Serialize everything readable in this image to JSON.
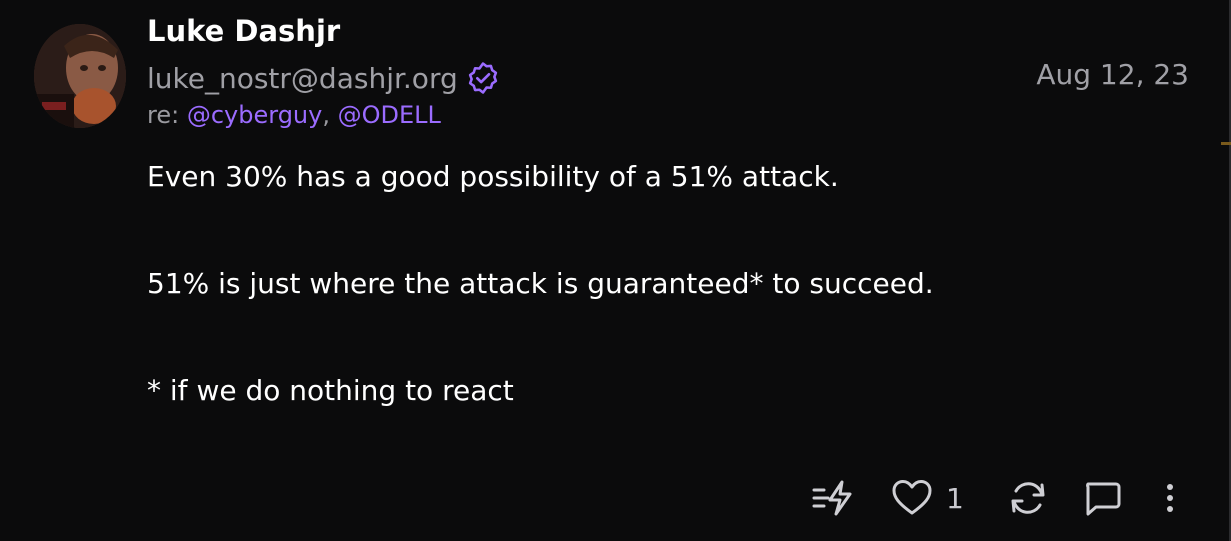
{
  "post": {
    "author_name": "Luke Dashjr",
    "handle": "luke_nostr@dashjr.org",
    "date": "Aug 12, 23",
    "reply_prefix": "re:",
    "mentions": [
      "@cyberguy",
      "@ODELL"
    ],
    "mention_separator": ",",
    "lines": [
      "Even 30% has a good possibility of a 51% attack.",
      "51% is just where the attack is guaranteed* to succeed.",
      "* if we do nothing to react"
    ]
  },
  "actions": {
    "like_count": "1",
    "icons": [
      "zap-icon",
      "heart-icon",
      "repost-icon",
      "reply-icon",
      "more-icon"
    ]
  },
  "colors": {
    "background": "#0b0b0c",
    "accent": "#9b6cff",
    "muted": "#a0a0a6",
    "text": "#ffffff"
  }
}
